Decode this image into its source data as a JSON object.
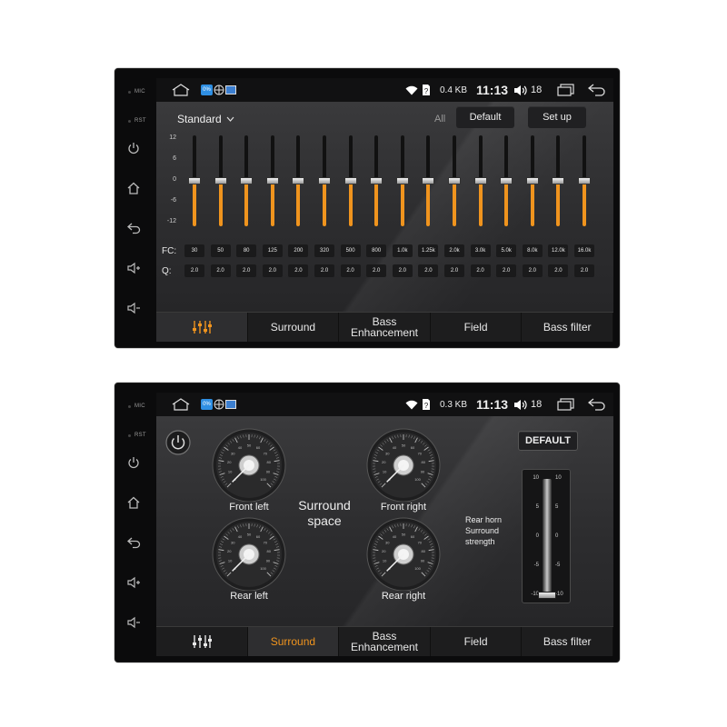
{
  "device": {
    "mic_label": "MIC",
    "rst_label": "RST",
    "side_buttons": [
      "power-icon",
      "home-icon",
      "back-icon",
      "volume-up-icon",
      "volume-down-icon"
    ]
  },
  "status_bar": {
    "screen1": {
      "data_rate": "0.4 KB",
      "time": "11:13",
      "volume": "18"
    },
    "screen2": {
      "data_rate": "0.3 KB",
      "time": "11:13",
      "volume": "18"
    }
  },
  "tabs": {
    "eq_icon": "equalizer-sliders-icon",
    "surround": "Surround",
    "bass_line1": "Bass",
    "bass_line2": "Enhancement",
    "field": "Field",
    "bass_filter": "Bass filter"
  },
  "equalizer": {
    "preset": "Standard",
    "all_label": "All",
    "default_button": "Default",
    "setup_button": "Set up",
    "scale": [
      "12",
      "6",
      "0",
      "-6",
      "-12"
    ],
    "fc_label": "FC:",
    "q_label": "Q:",
    "frequencies": [
      "30",
      "50",
      "80",
      "125",
      "200",
      "320",
      "500",
      "800",
      "1.0k",
      "1.25k",
      "2.0k",
      "3.0k",
      "5.0k",
      "8.0k",
      "12.0k",
      "16.0k"
    ],
    "q_values": [
      "2.0",
      "2.0",
      "2.0",
      "2.0",
      "2.0",
      "2.0",
      "2.0",
      "2.0",
      "2.0",
      "2.0",
      "2.0",
      "2.0",
      "2.0",
      "2.0",
      "2.0",
      "2.0"
    ],
    "gains": [
      0,
      0,
      0,
      0,
      0,
      0,
      0,
      0,
      0,
      0,
      0,
      0,
      0,
      0,
      0,
      0
    ],
    "accent_color": "#f0941e"
  },
  "surround": {
    "default_button": "DEFAULT",
    "center_line1": "Surround",
    "center_line2": "space",
    "dial_ticks": [
      "0",
      "10",
      "20",
      "30",
      "40",
      "50",
      "60",
      "70",
      "80",
      "90",
      "100"
    ],
    "dials": [
      {
        "label": "Front left"
      },
      {
        "label": "Front right"
      },
      {
        "label": "Rear left"
      },
      {
        "label": "Rear right"
      }
    ],
    "rear_horn_line1": "Rear horn",
    "rear_horn_line2": "Surround",
    "rear_horn_line3": "strength",
    "strength_scale": [
      "10",
      "5",
      "0",
      "-5",
      "-10"
    ],
    "strength_value": -10
  }
}
